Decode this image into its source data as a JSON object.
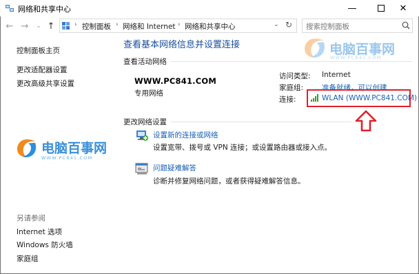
{
  "window": {
    "title": "网络和共享中心"
  },
  "address": {
    "breadcrumbs": [
      "控制面板",
      "网络和 Internet",
      "网络和共享中心"
    ],
    "search_placeholder": "搜索控制面板"
  },
  "sidebar": {
    "home": "控制面板主页",
    "links": [
      "更改适配器设置",
      "更改高级共享设置"
    ],
    "see_also_heading": "另请参阅",
    "see_also": [
      "Internet 选项",
      "Windows 防火墙",
      "家庭组"
    ]
  },
  "main": {
    "title": "查看基本网络信息并设置连接",
    "active_networks_label": "查看活动网络",
    "network": {
      "name": "WWW.PC841.COM",
      "type": "专用网络",
      "access_type_label": "访问类型:",
      "access_type_value": "Internet",
      "homegroup_label": "家庭组:",
      "homegroup_value": "准备就绪，可以创建",
      "connections_label": "连接:",
      "connection_value": "WLAN (WWW.PC841.COM)"
    },
    "change_settings_label": "更改网络设置",
    "tasks": [
      {
        "title": "设置新的连接或网络",
        "desc": "设置宽带、拨号或 VPN 连接；或设置路由器或接入点。"
      },
      {
        "title": "问题疑难解答",
        "desc": "诊断并修复网络问题，或者获得疑难解答信息。"
      }
    ]
  },
  "watermark": {
    "brand": "电脑百事网",
    "url": "WWW.PC841.COM"
  },
  "colors": {
    "accent": "#1a5fb4",
    "highlight": "#e0202a"
  }
}
